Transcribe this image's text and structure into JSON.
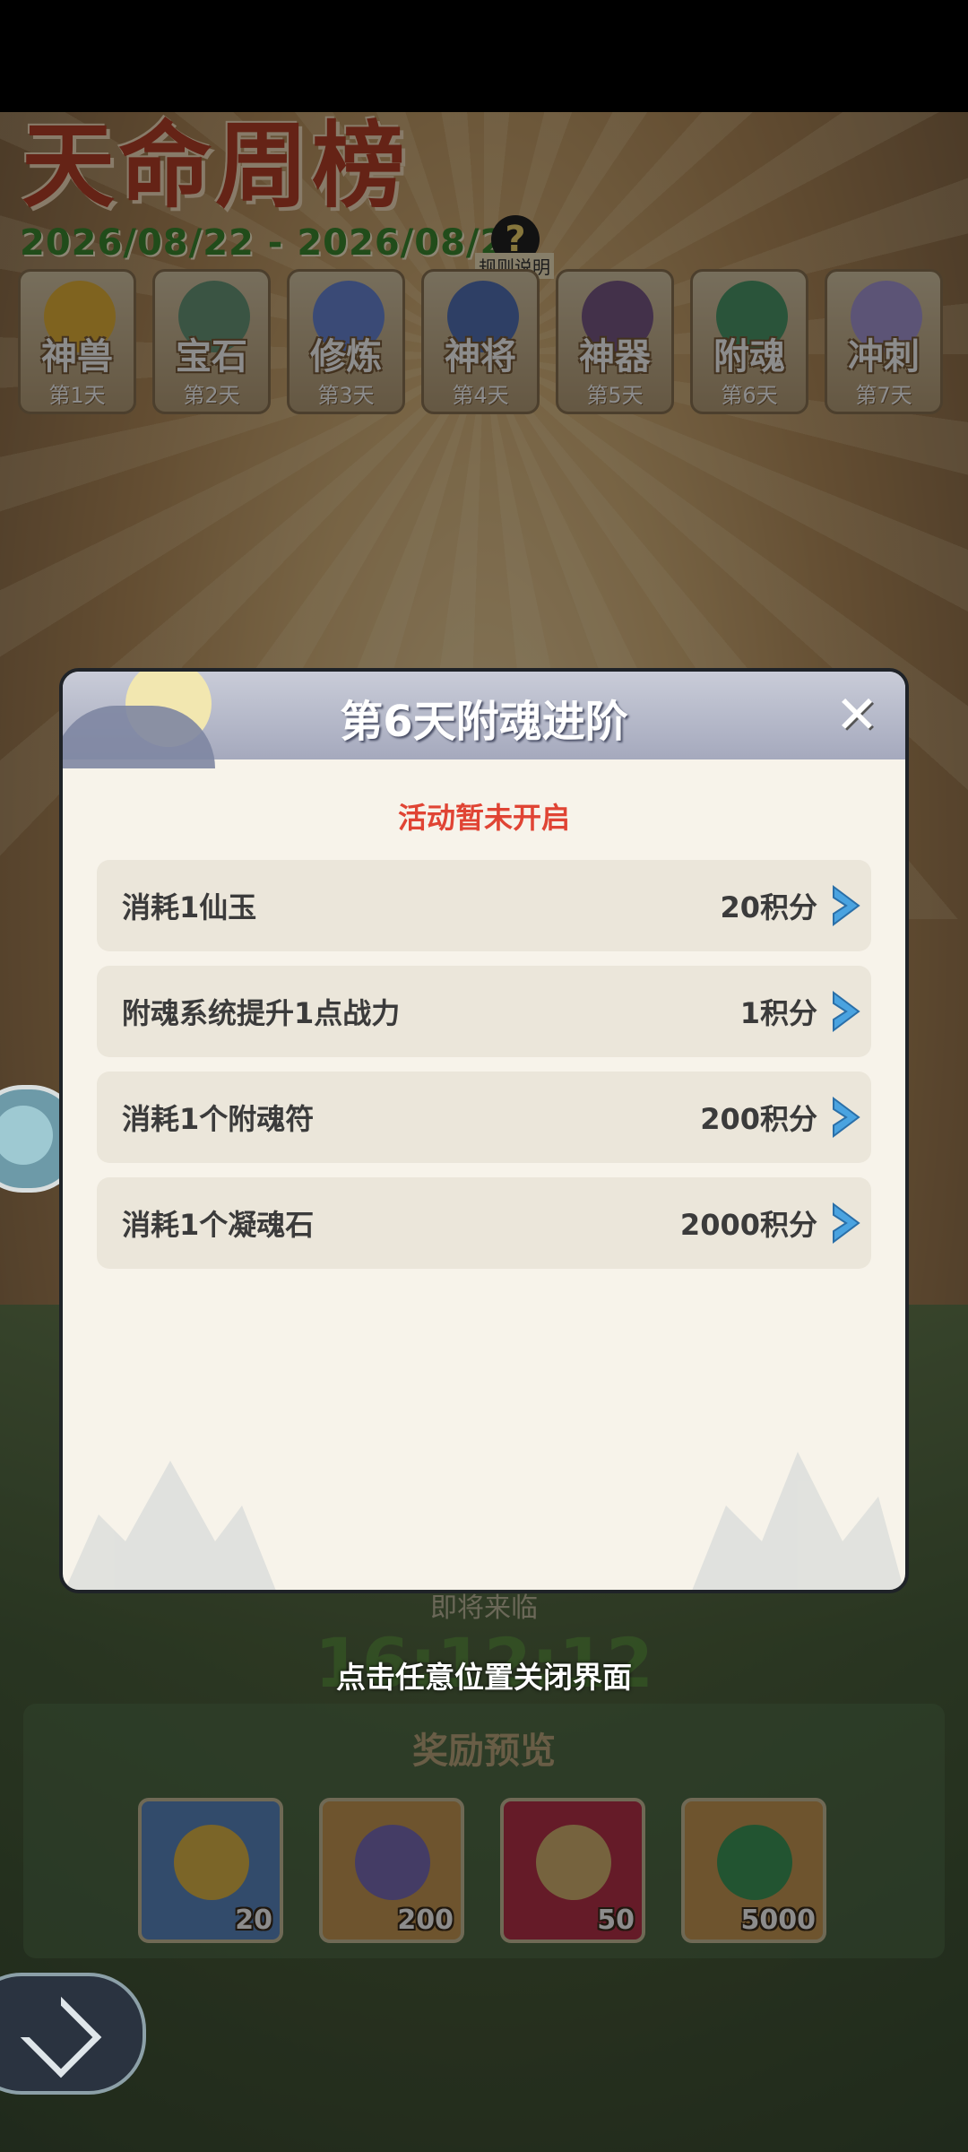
{
  "page": {
    "title_art": "天命周榜",
    "date_range": "2026/08/22 - 2026/08/29",
    "help_label": "规则说明",
    "help_glyph": "?"
  },
  "days": [
    {
      "name": "神兽",
      "day": "第1天",
      "color": "#e8b43a"
    },
    {
      "name": "宝石",
      "day": "第2天",
      "color": "#6a9a7a"
    },
    {
      "name": "修炼",
      "day": "第3天",
      "color": "#6a88d8"
    },
    {
      "name": "神将",
      "day": "第4天",
      "color": "#5574b8"
    },
    {
      "name": "神器",
      "day": "第5天",
      "color": "#7a5a88"
    },
    {
      "name": "附魂",
      "day": "第6天",
      "color": "#4e9a6a"
    },
    {
      "name": "冲刺",
      "day": "第7天",
      "color": "#a89ad8"
    }
  ],
  "background": {
    "timer_label": "即将来临",
    "timer": "16:12:12",
    "close_hint": "点击任意位置关闭界面",
    "rewards_title": "奖励预览",
    "rewards": [
      {
        "count": "20",
        "bg": "#5c89c4",
        "icon": "#e0b84a"
      },
      {
        "count": "200",
        "bg": "#c99a54",
        "icon": "#7c6eb8"
      },
      {
        "count": "50",
        "bg": "#b8324a",
        "icon": "#d8b472"
      },
      {
        "count": "5000",
        "bg": "#c99a54",
        "icon": "#3e9a5a"
      }
    ]
  },
  "modal": {
    "title": "第6天附魂进阶",
    "close_glyph": "✕",
    "status": "活动暂未开启",
    "tasks": [
      {
        "label": "消耗1仙玉",
        "points": "20积分"
      },
      {
        "label": "附魂系统提升1点战力",
        "points": "1积分"
      },
      {
        "label": "消耗1个附魂符",
        "points": "200积分"
      },
      {
        "label": "消耗1个凝魂石",
        "points": "2000积分"
      }
    ]
  },
  "colors": {
    "accent_red": "#e04434",
    "arrow_blue": "#4aa3e0"
  }
}
